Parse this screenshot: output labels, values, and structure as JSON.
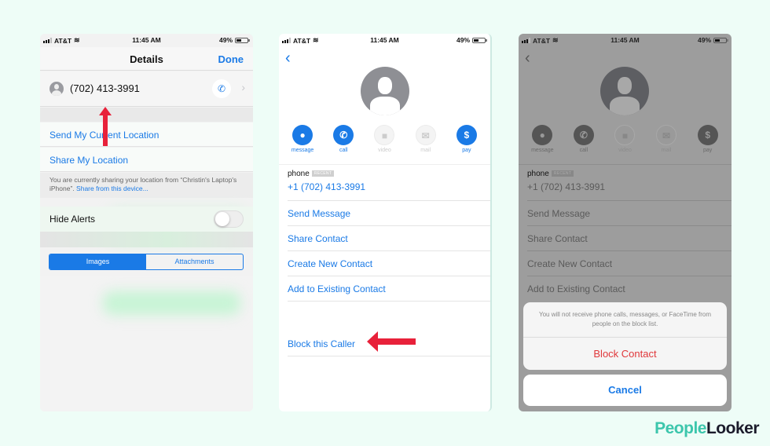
{
  "colors": {
    "background": "#eefdf7",
    "ios_blue": "#1a7ae6",
    "destructive_red": "#e0373a",
    "annotation_arrow": "#e8213a",
    "logo_teal": "#3cc6ac",
    "logo_dark": "#1b1b2b"
  },
  "status_bar": {
    "carrier": "AT&T",
    "time": "11:45 AM",
    "battery": "49%",
    "battery_level": 0.49
  },
  "panel1": {
    "nav_title": "Details",
    "done_label": "Done",
    "contact_number": "(702) 413-3991",
    "send_location": "Send My Current Location",
    "share_location": "Share My Location",
    "sharing_note": "You are currently sharing your location from “Christin's Laptop's iPhone”.",
    "sharing_link": "Share from this device...",
    "hide_alerts": "Hide Alerts",
    "hide_alerts_on": false,
    "segments": [
      {
        "label": "Images",
        "active": true
      },
      {
        "label": "Attachments",
        "active": false
      }
    ]
  },
  "contact_card": {
    "actions": [
      {
        "label": "message",
        "icon": "message-bubble-icon",
        "glyph": "●",
        "enabled": true
      },
      {
        "label": "call",
        "icon": "phone-icon",
        "glyph": "✆",
        "enabled": true
      },
      {
        "label": "video",
        "icon": "video-camera-icon",
        "glyph": "■",
        "enabled": false
      },
      {
        "label": "mail",
        "icon": "envelope-icon",
        "glyph": "✉",
        "enabled": false
      },
      {
        "label": "pay",
        "icon": "dollar-icon",
        "glyph": "$",
        "enabled": true
      }
    ],
    "phone_type": "phone",
    "phone_badge": "RECENT",
    "phone_number": "+1 (702) 413-3991",
    "options": [
      "Send Message",
      "Share Contact",
      "Create New Contact",
      "Add to Existing Contact"
    ],
    "block_caller": "Block this Caller"
  },
  "action_sheet": {
    "message": "You will not receive phone calls, messages, or FaceTime from people on the block list.",
    "block_label": "Block Contact",
    "cancel_label": "Cancel"
  },
  "logo": {
    "part1": "People",
    "part2": "Looker"
  }
}
